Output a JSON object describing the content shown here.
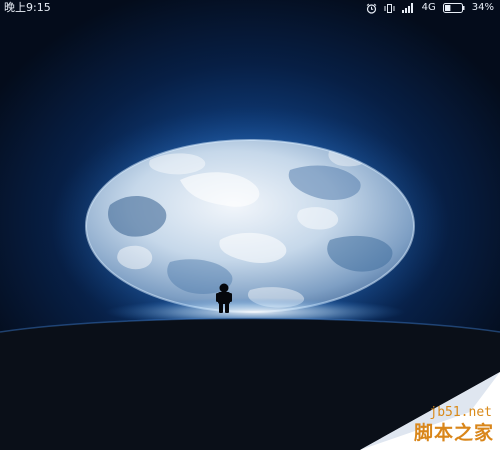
{
  "status_bar": {
    "time": "晚上9:15",
    "alarm_icon": "alarm-clock-icon",
    "mute_icon": "vibrate-off-icon",
    "signal_icon": "cellular-signal-icon",
    "network_type": "4G",
    "battery_icon": "battery-icon",
    "battery_percent": "34%",
    "battery_level": 0.34
  },
  "wallpaper": {
    "subject": "earth-planet",
    "figure": "astronaut-silhouette"
  },
  "watermark": {
    "domain": "jb51.net",
    "brand": "脚本之家",
    "color": "#d98a1a"
  },
  "colors": {
    "sky_glow": "#1d5fae",
    "background": "#040c1b",
    "ground": "#0a0f18"
  }
}
